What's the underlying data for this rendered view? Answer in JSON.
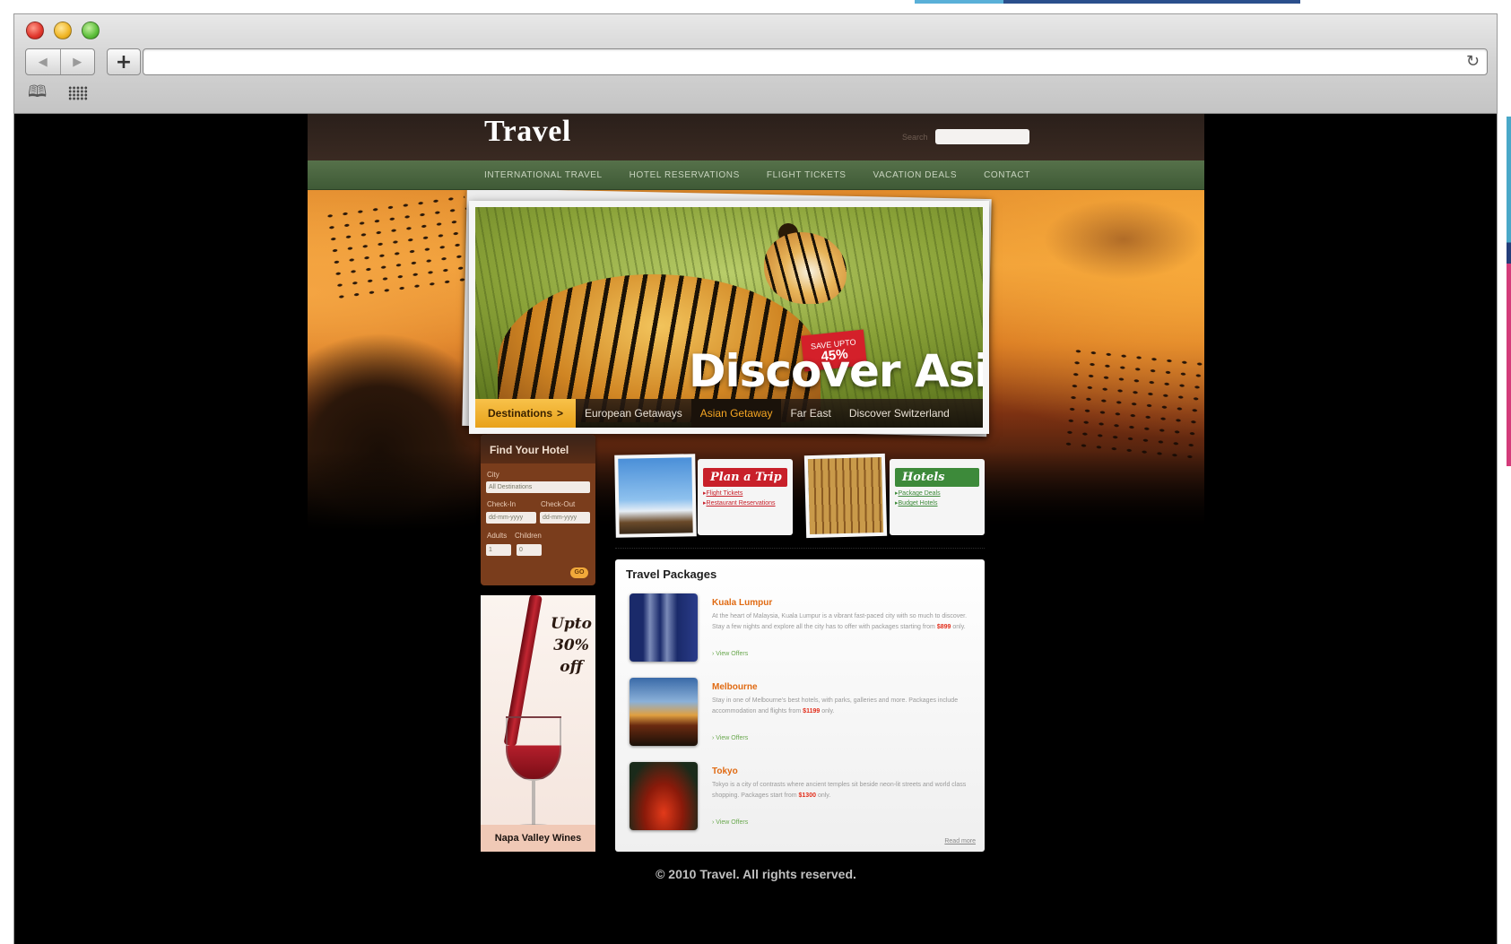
{
  "browser": {
    "back_glyph": "◀",
    "forward_glyph": "▶",
    "new_tab_glyph": "+",
    "reload_glyph": "↻",
    "bookmarks_glyph": "🕮",
    "url": ""
  },
  "site": {
    "logo": "Travel",
    "search_label": "Search",
    "search_placeholder": "",
    "nav": [
      "International Travel",
      "Hotel Reservations",
      "Flight Tickets",
      "Vacation Deals",
      "Contact"
    ]
  },
  "hero": {
    "badge_top": "SAVE upto",
    "badge_percent": "45%",
    "title": "Discover Asia",
    "destinations_label": "Destinations",
    "destinations_arrow": ">",
    "destination_links": [
      "European Getaways",
      "Asian Getaway",
      "Far East",
      "Discover Switzerland"
    ],
    "active_destination_index": 1
  },
  "hotel_search": {
    "title": "Find Your Hotel",
    "city_label": "City",
    "city_value": "All Destinations",
    "checkin_label": "Check-In",
    "checkin_value": "dd-mm-yyyy",
    "checkout_label": "Check-Out",
    "checkout_value": "dd-mm-yyyy",
    "adults_label": "Adults",
    "adults_value": "1",
    "children_label": "Children",
    "children_value": "0",
    "go_label": "GO"
  },
  "ad": {
    "promo": "Upto 30% off",
    "caption": "Napa Valley Wines"
  },
  "cards": [
    {
      "title": "Plan a Trip",
      "links": [
        "Flight Tickets",
        "Restaurant Reservations"
      ],
      "color": "#c8202a",
      "link_color": "#c8202a"
    },
    {
      "title": "Hotels",
      "links": [
        "Package Deals",
        "Budget Hotels"
      ],
      "color": "#3d8a3a",
      "link_color": "#3d8a3a"
    }
  ],
  "packages": {
    "title": "Travel Packages",
    "items": [
      {
        "name": "Kuala Lumpur",
        "desc": "At the heart of Malaysia, Kuala Lumpur is a vibrant fast-paced city with so much to discover. Stay a few nights and explore all the city has to offer with packages starting from",
        "price": "$899",
        "price_suffix": "only.",
        "offer": "View Offers"
      },
      {
        "name": "Melbourne",
        "desc": "Stay in one of Melbourne's best hotels, with parks, galleries and more. Packages include accommodation and flights from",
        "price": "$1199",
        "price_suffix": "only.",
        "offer": "View Offers"
      },
      {
        "name": "Tokyo",
        "desc": "Tokyo is a city of contrasts where ancient temples sit beside neon-lit streets and world class shopping. Packages start from",
        "price": "$1300",
        "price_suffix": "only.",
        "offer": "View Offers"
      }
    ],
    "read_more": "Read more"
  },
  "footer": {
    "copyright": "© 2010 Travel. All rights reserved."
  },
  "colors": {
    "accent_orange": "#e06a12",
    "nav_green": "#4d6a42",
    "hotel_brown": "#7a3d1c",
    "price_red": "#e22d1a"
  }
}
